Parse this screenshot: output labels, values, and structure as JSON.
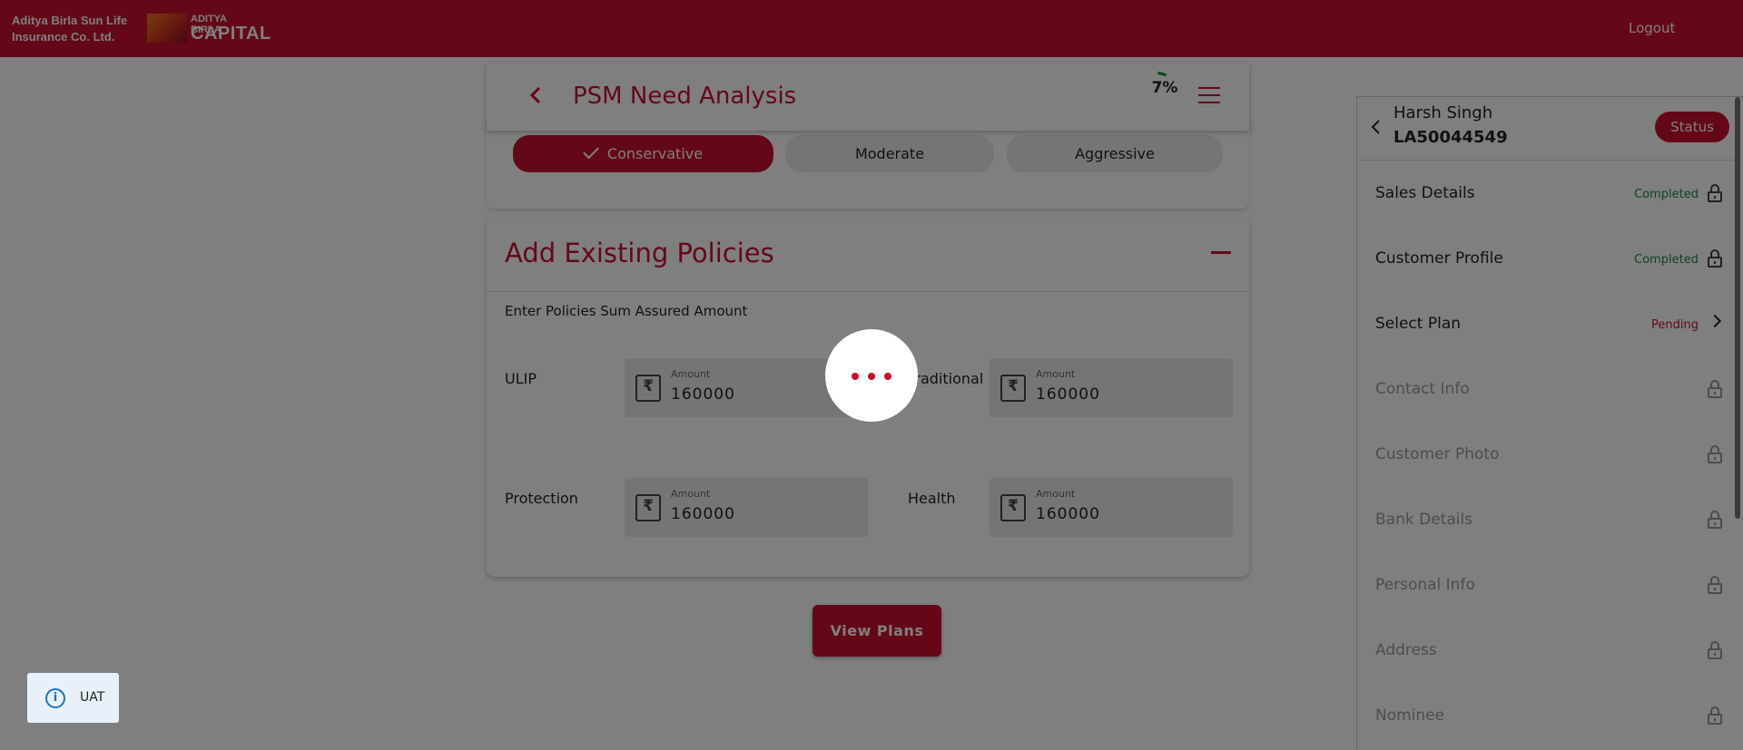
{
  "topbar": {
    "brand_line1": "Aditya Birla Sun Life",
    "brand_line2": "Insurance Co. Ltd.",
    "logo_line1": "ADITYA BIRLA",
    "logo_line2": "CAPITAL",
    "logout": "Logout",
    "color": "#c8102e"
  },
  "header": {
    "title": "PSM Need Analysis",
    "progress": "7%",
    "back_icon": "chevron-left-icon",
    "menu_icon": "hamburger-menu-icon"
  },
  "risk_profile": {
    "options": [
      "Conservative",
      "Moderate",
      "Aggressive"
    ],
    "selected": "Conservative"
  },
  "existing_policies": {
    "title": "Add Existing Policies",
    "subtitle": "Enter Policies Sum Assured Amount",
    "fields": [
      {
        "label": "ULIP",
        "placeholder": "Amount",
        "value": "160000"
      },
      {
        "label": "Traditional",
        "placeholder": "Amount",
        "value": "160000"
      },
      {
        "label": "Protection",
        "placeholder": "Amount",
        "value": "160000"
      },
      {
        "label": "Health",
        "placeholder": "Amount",
        "value": "160000"
      }
    ]
  },
  "view_plans": "View Plans",
  "sidebar": {
    "name": "Harsh Singh",
    "id": "LA50044549",
    "status_button": "Status",
    "items": [
      {
        "label": "Sales Details",
        "status": "Completed",
        "state": "done"
      },
      {
        "label": "Customer Profile",
        "status": "Completed",
        "state": "done"
      },
      {
        "label": "Select Plan",
        "status": "Pending",
        "state": "pending"
      },
      {
        "label": "Contact Info",
        "status": "",
        "state": "locked"
      },
      {
        "label": "Customer Photo",
        "status": "",
        "state": "locked"
      },
      {
        "label": "Bank Details",
        "status": "",
        "state": "locked"
      },
      {
        "label": "Personal Info",
        "status": "",
        "state": "locked"
      },
      {
        "label": "Address",
        "status": "",
        "state": "locked"
      },
      {
        "label": "Nominee",
        "status": "",
        "state": "locked"
      }
    ]
  },
  "env_badge": "UAT",
  "loader": "loading-dots-icon"
}
